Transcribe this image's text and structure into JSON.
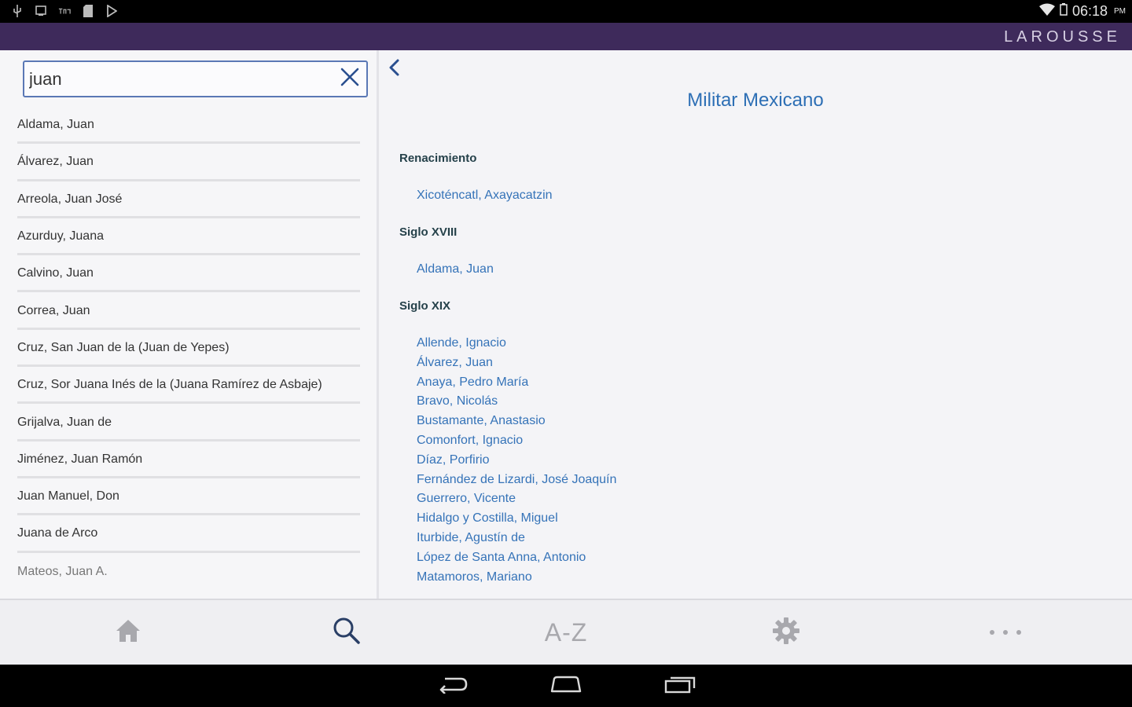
{
  "status": {
    "time": "06:18",
    "ampm": "PM"
  },
  "brand": "LAROUSSE",
  "search": {
    "value": "juan"
  },
  "results": [
    "Aldama, Juan",
    "Álvarez, Juan",
    "Arreola, Juan José",
    "Azurduy, Juana",
    "Calvino, Juan",
    "Correa, Juan",
    "Cruz, San Juan de la (Juan de Yepes)",
    "Cruz, Sor Juana Inés de la (Juana Ramírez de Asbaje)",
    "Grijalva, Juan de",
    "Jiménez, Juan Ramón",
    "Juan Manuel, Don",
    "Juana de Arco",
    "Mateos, Juan A."
  ],
  "detail": {
    "title": "Militar Mexicano",
    "sections": [
      {
        "heading": "Renacimiento",
        "links": [
          "Xicoténcatl, Axayacatzin"
        ]
      },
      {
        "heading": "Siglo XVIII",
        "links": [
          "Aldama, Juan"
        ]
      },
      {
        "heading": "Siglo XIX",
        "links": [
          "Allende, Ignacio",
          "Álvarez, Juan",
          "Anaya, Pedro María",
          "Bravo, Nicolás",
          "Bustamante, Anastasio",
          "Comonfort, Ignacio",
          "Díaz, Porfirio",
          "Fernández de Lizardi, José Joaquín",
          "Guerrero, Vicente",
          "Hidalgo y Costilla, Miguel",
          "Iturbide, Agustín de",
          "López de Santa Anna, Antonio",
          "Matamoros, Mariano"
        ]
      }
    ]
  },
  "nav": {
    "az_label": "A-Z",
    "active": "search"
  },
  "icons": {
    "clear": "close-icon",
    "back": "chevron-left-icon",
    "home": "home-icon",
    "search": "search-icon",
    "settings": "gear-icon",
    "more": "more-icon",
    "sys_back": "back-icon",
    "sys_home": "home-outline-icon",
    "sys_recents": "recents-icon"
  },
  "colors": {
    "brand_bar": "#3e2a5b",
    "link": "#3573b8",
    "title": "#2d6fb5",
    "heading": "#25414a",
    "search_border": "#5a78b5",
    "active_nav": "#2a3f66",
    "inactive_nav": "#a8a8ad"
  }
}
